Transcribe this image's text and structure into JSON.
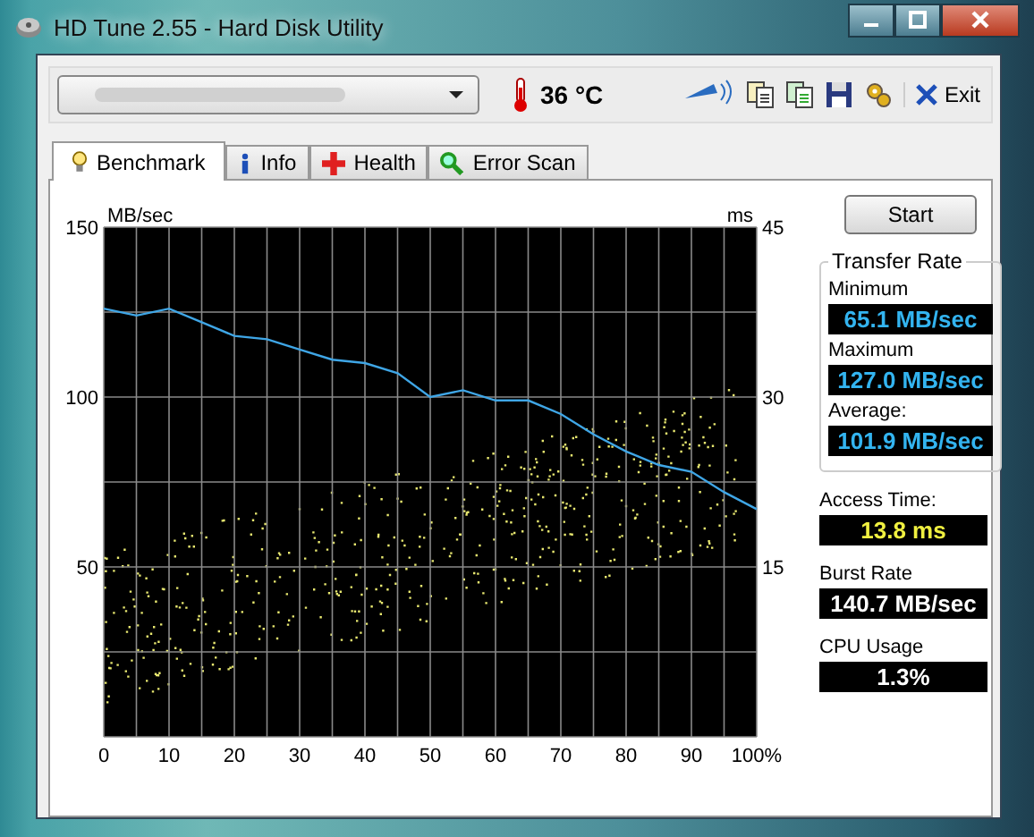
{
  "window": {
    "title": "HD Tune 2.55 - Hard Disk Utility"
  },
  "toolbar": {
    "temperature": "36 °C",
    "exit_label": "Exit"
  },
  "tabs": [
    {
      "label": "Benchmark",
      "selected": true
    },
    {
      "label": "Info",
      "selected": false
    },
    {
      "label": "Health",
      "selected": false
    },
    {
      "label": "Error Scan",
      "selected": false
    }
  ],
  "benchmark": {
    "right_axis": {
      "label": "ms",
      "ticks": [
        "45",
        "30",
        "15"
      ]
    },
    "chart_data": {
      "type": "line",
      "grid": true,
      "ylabel": "MB/sec",
      "x": [
        0,
        5,
        10,
        15,
        20,
        25,
        30,
        35,
        40,
        45,
        50,
        55,
        60,
        65,
        70,
        75,
        80,
        85,
        90,
        95,
        100
      ],
      "ylim": [
        0,
        150
      ],
      "xlim": [
        0,
        100
      ],
      "yticks": [
        50,
        100,
        150
      ],
      "xticks": [
        0,
        10,
        20,
        30,
        40,
        50,
        60,
        70,
        80,
        90,
        {
          "value": 100,
          "label": "100%"
        }
      ],
      "series": [
        {
          "color": "#3fa6e6",
          "values": [
            126,
            124,
            126,
            122,
            118,
            117,
            114,
            111,
            110,
            107,
            100,
            102,
            99,
            99,
            95,
            89,
            84,
            80,
            78,
            72,
            67
          ]
        }
      ]
    }
  },
  "start_button": "Start",
  "transfer_rate": {
    "title": "Transfer Rate",
    "readouts": [
      {
        "label": "Minimum",
        "value": "65.1 MB/sec"
      },
      {
        "label": "Maximum",
        "value": "127.0 MB/sec"
      },
      {
        "label": "Average:",
        "value": "101.9 MB/sec"
      }
    ]
  },
  "stats": [
    {
      "label": "Access Time:",
      "value": "13.8 ms",
      "kind": "highlighted"
    },
    {
      "label": "Burst Rate",
      "value": "140.7 MB/sec",
      "kind": "plain"
    },
    {
      "label": "CPU Usage",
      "value": "1.3%",
      "kind": "plain"
    }
  ]
}
